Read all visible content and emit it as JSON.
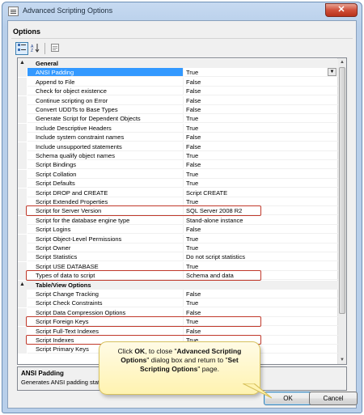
{
  "window": {
    "title": "Advanced Scripting Options",
    "close_glyph": "✕"
  },
  "options_title": "Options",
  "toolbar": {
    "categorized_icon": "categorized-icon",
    "alphabetical_icon": "alphabetical-icon",
    "property_pages_icon": "property-pages-icon"
  },
  "grid": {
    "rows": [
      {
        "type": "category",
        "name": "General",
        "sign": "▲"
      },
      {
        "name": "ANSI Padding",
        "value": "True",
        "selected": true
      },
      {
        "name": "Append to File",
        "value": "False"
      },
      {
        "name": "Check for object existence",
        "value": "False"
      },
      {
        "name": "Continue scripting on Error",
        "value": "False"
      },
      {
        "name": "Convert UDDTs to Base Types",
        "value": "False"
      },
      {
        "name": "Generate Script for Dependent Objects",
        "value": "True"
      },
      {
        "name": "Include Descriptive Headers",
        "value": "True"
      },
      {
        "name": "Include system constraint names",
        "value": "False"
      },
      {
        "name": "Include unsupported statements",
        "value": "False"
      },
      {
        "name": "Schema qualify object names",
        "value": "True"
      },
      {
        "name": "Script Bindings",
        "value": "False"
      },
      {
        "name": "Script Collation",
        "value": "True"
      },
      {
        "name": "Script Defaults",
        "value": "True"
      },
      {
        "name": "Script DROP and CREATE",
        "value": "Script CREATE"
      },
      {
        "name": "Script Extended Properties",
        "value": "True"
      },
      {
        "name": "Script for Server Version",
        "value": "SQL Server 2008 R2",
        "highlight": true
      },
      {
        "name": "Script for the database engine type",
        "value": "Stand-alone instance"
      },
      {
        "name": "Script Logins",
        "value": "False"
      },
      {
        "name": "Script Object-Level Permissions",
        "value": "True"
      },
      {
        "name": "Script Owner",
        "value": "True"
      },
      {
        "name": "Script Statistics",
        "value": "Do not script statistics"
      },
      {
        "name": "Script USE DATABASE",
        "value": "True"
      },
      {
        "name": "Types of data to script",
        "value": "Schema and data",
        "highlight": true
      },
      {
        "type": "category",
        "name": "Table/View Options",
        "sign": "▲"
      },
      {
        "name": "Script Change Tracking",
        "value": "False"
      },
      {
        "name": "Script Check Constraints",
        "value": "True"
      },
      {
        "name": "Script Data Compression Options",
        "value": "False"
      },
      {
        "name": "Script Foreign Keys",
        "value": "True",
        "highlight": true
      },
      {
        "name": "Script Full-Text Indexes",
        "value": "False"
      },
      {
        "name": "Script Indexes",
        "value": "True",
        "highlight": true
      },
      {
        "name": "Script Primary Keys",
        "value": ""
      }
    ]
  },
  "description": {
    "title": "ANSI Padding",
    "text": "Generates ANSI padding statements."
  },
  "callout": {
    "text_parts": [
      "Click ",
      "OK",
      ", to close \"",
      "Advanced Scripting Options",
      "\" dialog box and return to \"",
      "Set Scripting Options",
      "\" page."
    ]
  },
  "buttons": {
    "ok": "OK",
    "cancel": "Cancel"
  },
  "colors": {
    "highlight_border": "#c0392b",
    "selection": "#3399ff",
    "callout_bg": "#fff3b0"
  }
}
